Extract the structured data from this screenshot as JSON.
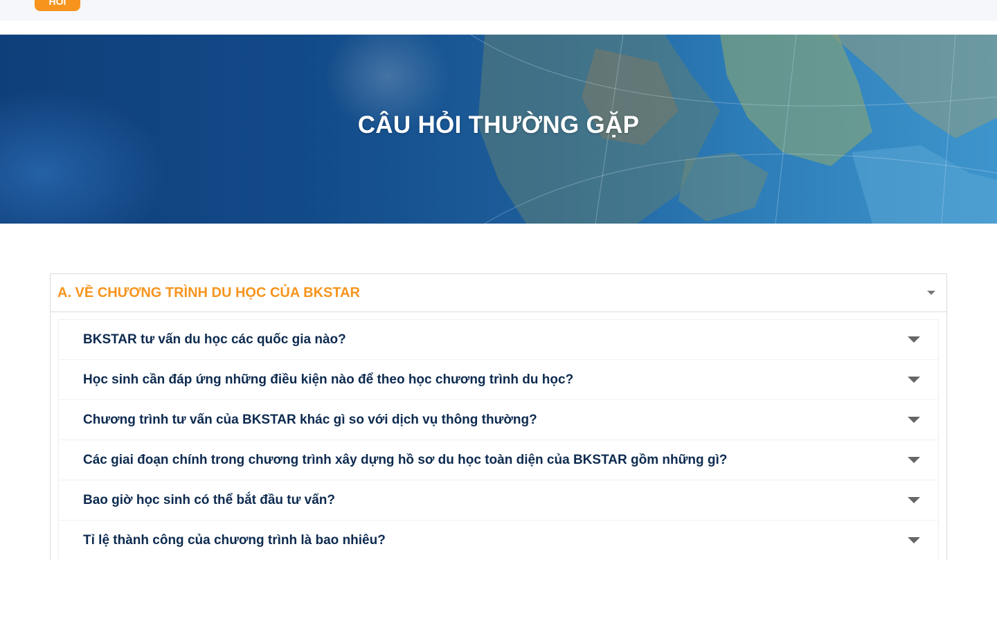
{
  "topbar": {
    "button_label": "HỎI"
  },
  "hero": {
    "title": "CÂU HỎI THƯỜNG GẶP"
  },
  "faq": {
    "section_title": "A. VỀ CHƯƠNG TRÌNH DU HỌC CỦA BKSTAR",
    "questions": [
      "BKSTAR tư vấn du học các quốc gia nào?",
      "Học sinh cần đáp ứng những điều kiện nào để theo học chương trình du học?",
      "Chương trình tư vấn của BKSTAR khác gì so với dịch vụ thông thường?",
      "Các giai đoạn chính trong chương trình xây dựng hồ sơ du học toàn diện của BKSTAR gồm những gì?",
      "Bao giờ học sinh có thể bắt đầu tư vấn?",
      "Tỉ lệ thành công của chương trình là bao nhiêu?"
    ]
  },
  "colors": {
    "accent": "#f7941d",
    "question_text": "#0d2a4f",
    "hero_blue": "#124a88"
  },
  "icons": {
    "section_toggle": "chevron-down-icon",
    "question_toggle": "chevron-down-icon"
  }
}
